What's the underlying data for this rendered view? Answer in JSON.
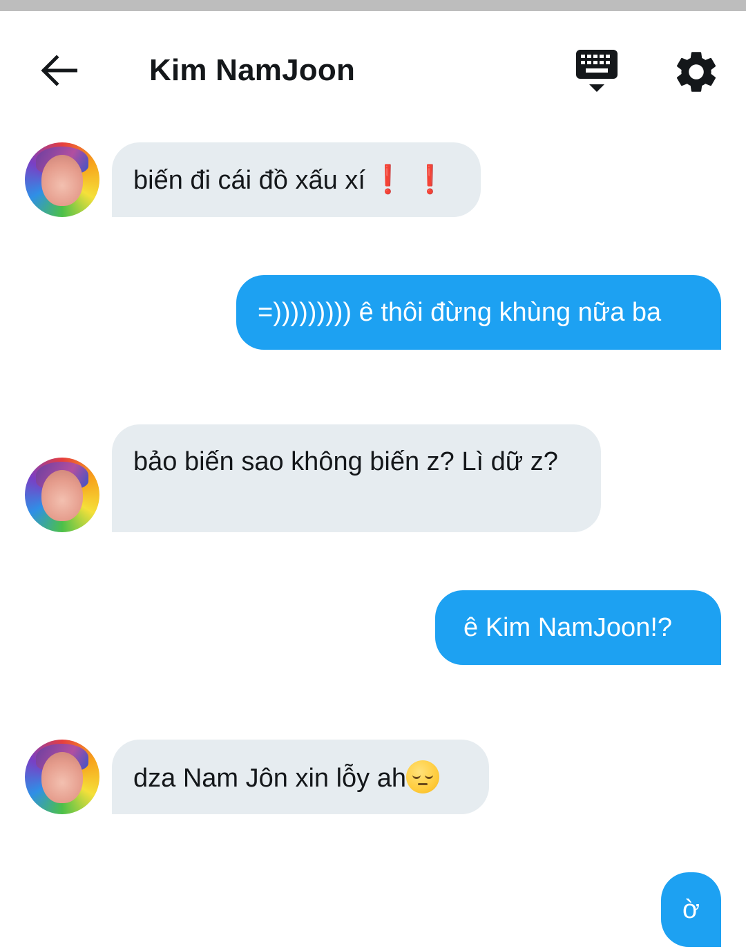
{
  "header": {
    "title": "Kim NamJoon",
    "back_icon": "arrow-left-icon",
    "keyboard_icon": "keyboard-hide-icon",
    "settings_icon": "gear-icon"
  },
  "colors": {
    "incoming_bubble": "#e6ecf0",
    "outgoing_bubble": "#1da1f2",
    "text": "#14171a"
  },
  "messages": [
    {
      "direction": "incoming",
      "text": "biến đi cái đồ xấu xí",
      "suffix": "❗ ❗"
    },
    {
      "direction": "outgoing",
      "text": "=))))))))) ê thôi đừng khùng nữa ba"
    },
    {
      "direction": "incoming",
      "text": "bảo biến sao không biến z? Lì dữ z?"
    },
    {
      "direction": "outgoing",
      "text": "ê Kim NamJoon!?"
    },
    {
      "direction": "incoming",
      "text": "dza Nam Jôn xin lỗy ah",
      "emoji": "pensive-face"
    },
    {
      "direction": "outgoing",
      "text": "ờ"
    }
  ]
}
